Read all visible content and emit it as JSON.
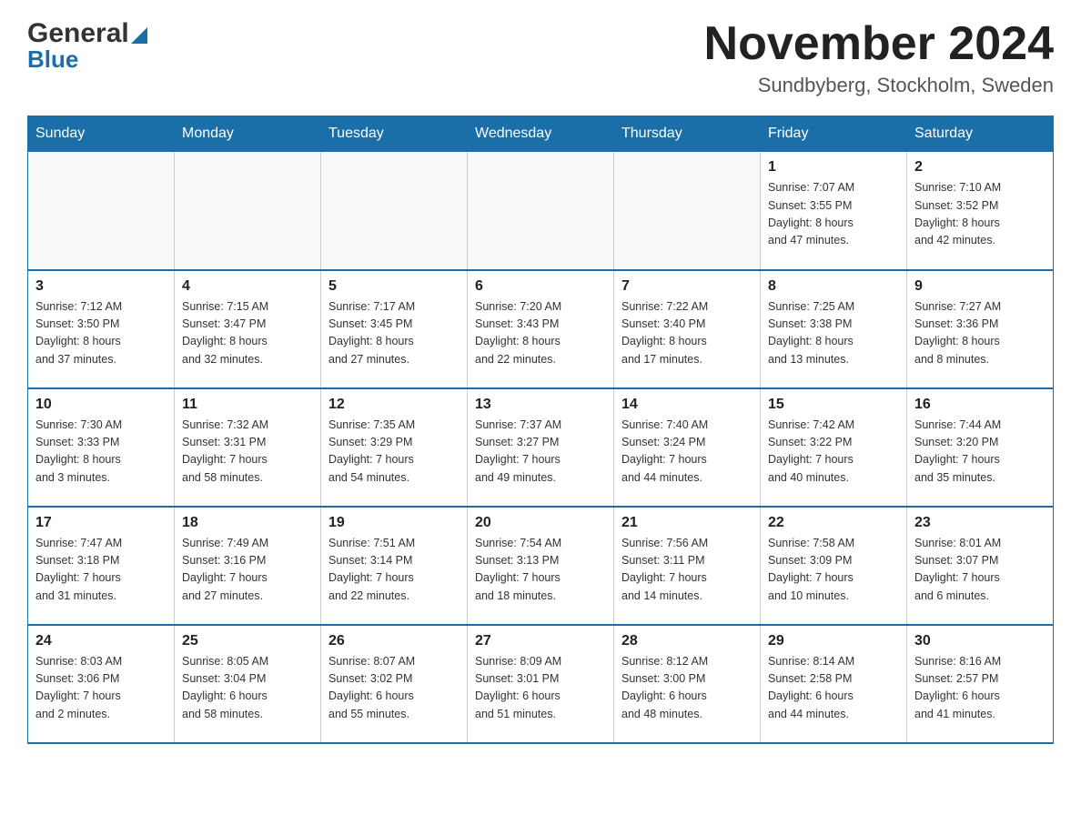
{
  "logo": {
    "general": "General",
    "blue": "Blue"
  },
  "header": {
    "month": "November 2024",
    "location": "Sundbyberg, Stockholm, Sweden"
  },
  "weekdays": [
    "Sunday",
    "Monday",
    "Tuesday",
    "Wednesday",
    "Thursday",
    "Friday",
    "Saturday"
  ],
  "weeks": [
    [
      {
        "day": "",
        "info": ""
      },
      {
        "day": "",
        "info": ""
      },
      {
        "day": "",
        "info": ""
      },
      {
        "day": "",
        "info": ""
      },
      {
        "day": "",
        "info": ""
      },
      {
        "day": "1",
        "info": "Sunrise: 7:07 AM\nSunset: 3:55 PM\nDaylight: 8 hours\nand 47 minutes."
      },
      {
        "day": "2",
        "info": "Sunrise: 7:10 AM\nSunset: 3:52 PM\nDaylight: 8 hours\nand 42 minutes."
      }
    ],
    [
      {
        "day": "3",
        "info": "Sunrise: 7:12 AM\nSunset: 3:50 PM\nDaylight: 8 hours\nand 37 minutes."
      },
      {
        "day": "4",
        "info": "Sunrise: 7:15 AM\nSunset: 3:47 PM\nDaylight: 8 hours\nand 32 minutes."
      },
      {
        "day": "5",
        "info": "Sunrise: 7:17 AM\nSunset: 3:45 PM\nDaylight: 8 hours\nand 27 minutes."
      },
      {
        "day": "6",
        "info": "Sunrise: 7:20 AM\nSunset: 3:43 PM\nDaylight: 8 hours\nand 22 minutes."
      },
      {
        "day": "7",
        "info": "Sunrise: 7:22 AM\nSunset: 3:40 PM\nDaylight: 8 hours\nand 17 minutes."
      },
      {
        "day": "8",
        "info": "Sunrise: 7:25 AM\nSunset: 3:38 PM\nDaylight: 8 hours\nand 13 minutes."
      },
      {
        "day": "9",
        "info": "Sunrise: 7:27 AM\nSunset: 3:36 PM\nDaylight: 8 hours\nand 8 minutes."
      }
    ],
    [
      {
        "day": "10",
        "info": "Sunrise: 7:30 AM\nSunset: 3:33 PM\nDaylight: 8 hours\nand 3 minutes."
      },
      {
        "day": "11",
        "info": "Sunrise: 7:32 AM\nSunset: 3:31 PM\nDaylight: 7 hours\nand 58 minutes."
      },
      {
        "day": "12",
        "info": "Sunrise: 7:35 AM\nSunset: 3:29 PM\nDaylight: 7 hours\nand 54 minutes."
      },
      {
        "day": "13",
        "info": "Sunrise: 7:37 AM\nSunset: 3:27 PM\nDaylight: 7 hours\nand 49 minutes."
      },
      {
        "day": "14",
        "info": "Sunrise: 7:40 AM\nSunset: 3:24 PM\nDaylight: 7 hours\nand 44 minutes."
      },
      {
        "day": "15",
        "info": "Sunrise: 7:42 AM\nSunset: 3:22 PM\nDaylight: 7 hours\nand 40 minutes."
      },
      {
        "day": "16",
        "info": "Sunrise: 7:44 AM\nSunset: 3:20 PM\nDaylight: 7 hours\nand 35 minutes."
      }
    ],
    [
      {
        "day": "17",
        "info": "Sunrise: 7:47 AM\nSunset: 3:18 PM\nDaylight: 7 hours\nand 31 minutes."
      },
      {
        "day": "18",
        "info": "Sunrise: 7:49 AM\nSunset: 3:16 PM\nDaylight: 7 hours\nand 27 minutes."
      },
      {
        "day": "19",
        "info": "Sunrise: 7:51 AM\nSunset: 3:14 PM\nDaylight: 7 hours\nand 22 minutes."
      },
      {
        "day": "20",
        "info": "Sunrise: 7:54 AM\nSunset: 3:13 PM\nDaylight: 7 hours\nand 18 minutes."
      },
      {
        "day": "21",
        "info": "Sunrise: 7:56 AM\nSunset: 3:11 PM\nDaylight: 7 hours\nand 14 minutes."
      },
      {
        "day": "22",
        "info": "Sunrise: 7:58 AM\nSunset: 3:09 PM\nDaylight: 7 hours\nand 10 minutes."
      },
      {
        "day": "23",
        "info": "Sunrise: 8:01 AM\nSunset: 3:07 PM\nDaylight: 7 hours\nand 6 minutes."
      }
    ],
    [
      {
        "day": "24",
        "info": "Sunrise: 8:03 AM\nSunset: 3:06 PM\nDaylight: 7 hours\nand 2 minutes."
      },
      {
        "day": "25",
        "info": "Sunrise: 8:05 AM\nSunset: 3:04 PM\nDaylight: 6 hours\nand 58 minutes."
      },
      {
        "day": "26",
        "info": "Sunrise: 8:07 AM\nSunset: 3:02 PM\nDaylight: 6 hours\nand 55 minutes."
      },
      {
        "day": "27",
        "info": "Sunrise: 8:09 AM\nSunset: 3:01 PM\nDaylight: 6 hours\nand 51 minutes."
      },
      {
        "day": "28",
        "info": "Sunrise: 8:12 AM\nSunset: 3:00 PM\nDaylight: 6 hours\nand 48 minutes."
      },
      {
        "day": "29",
        "info": "Sunrise: 8:14 AM\nSunset: 2:58 PM\nDaylight: 6 hours\nand 44 minutes."
      },
      {
        "day": "30",
        "info": "Sunrise: 8:16 AM\nSunset: 2:57 PM\nDaylight: 6 hours\nand 41 minutes."
      }
    ]
  ]
}
